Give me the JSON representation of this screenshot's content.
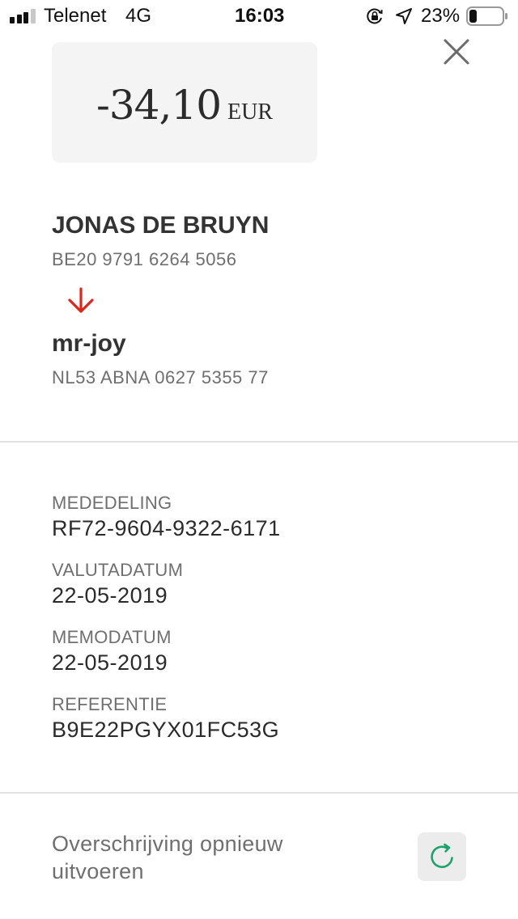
{
  "status_bar": {
    "carrier": "Telenet",
    "network": "4G",
    "time": "16:03",
    "battery_percent": "23%",
    "signal_bars_filled": 3,
    "signal_bars_total": 4,
    "battery_level": 0.23,
    "icons": [
      "orientation-lock-icon",
      "location-arrow-icon",
      "battery-icon"
    ]
  },
  "header": {
    "close_icon": "close-icon"
  },
  "amount": {
    "value": "-34,10",
    "currency": "EUR"
  },
  "sender": {
    "name": "JONAS DE BRUYN",
    "iban": "BE20 9791 6264 5056"
  },
  "flow_icon": "arrow-down-icon",
  "recipient": {
    "name": "mr-joy",
    "iban": "NL53 ABNA 0627 5355 77"
  },
  "details": [
    {
      "label": "MEDEDELING",
      "value": "RF72-9604-9322-6171"
    },
    {
      "label": "VALUTADATUM",
      "value": "22-05-2019"
    },
    {
      "label": "MEMODATUM",
      "value": "22-05-2019"
    },
    {
      "label": "REFERENTIE",
      "value": "B9E22PGYX01FC53G"
    }
  ],
  "repeat": {
    "label": "Overschrijving opnieuw uitvoeren",
    "icon": "refresh-icon"
  },
  "colors": {
    "text_primary": "#2b2b2b",
    "text_secondary": "#6f6f6f",
    "arrow_red": "#e2231a",
    "refresh_green": "#1aa36b",
    "card_background": "#f4f4f4",
    "divider": "#e2e2e2"
  }
}
